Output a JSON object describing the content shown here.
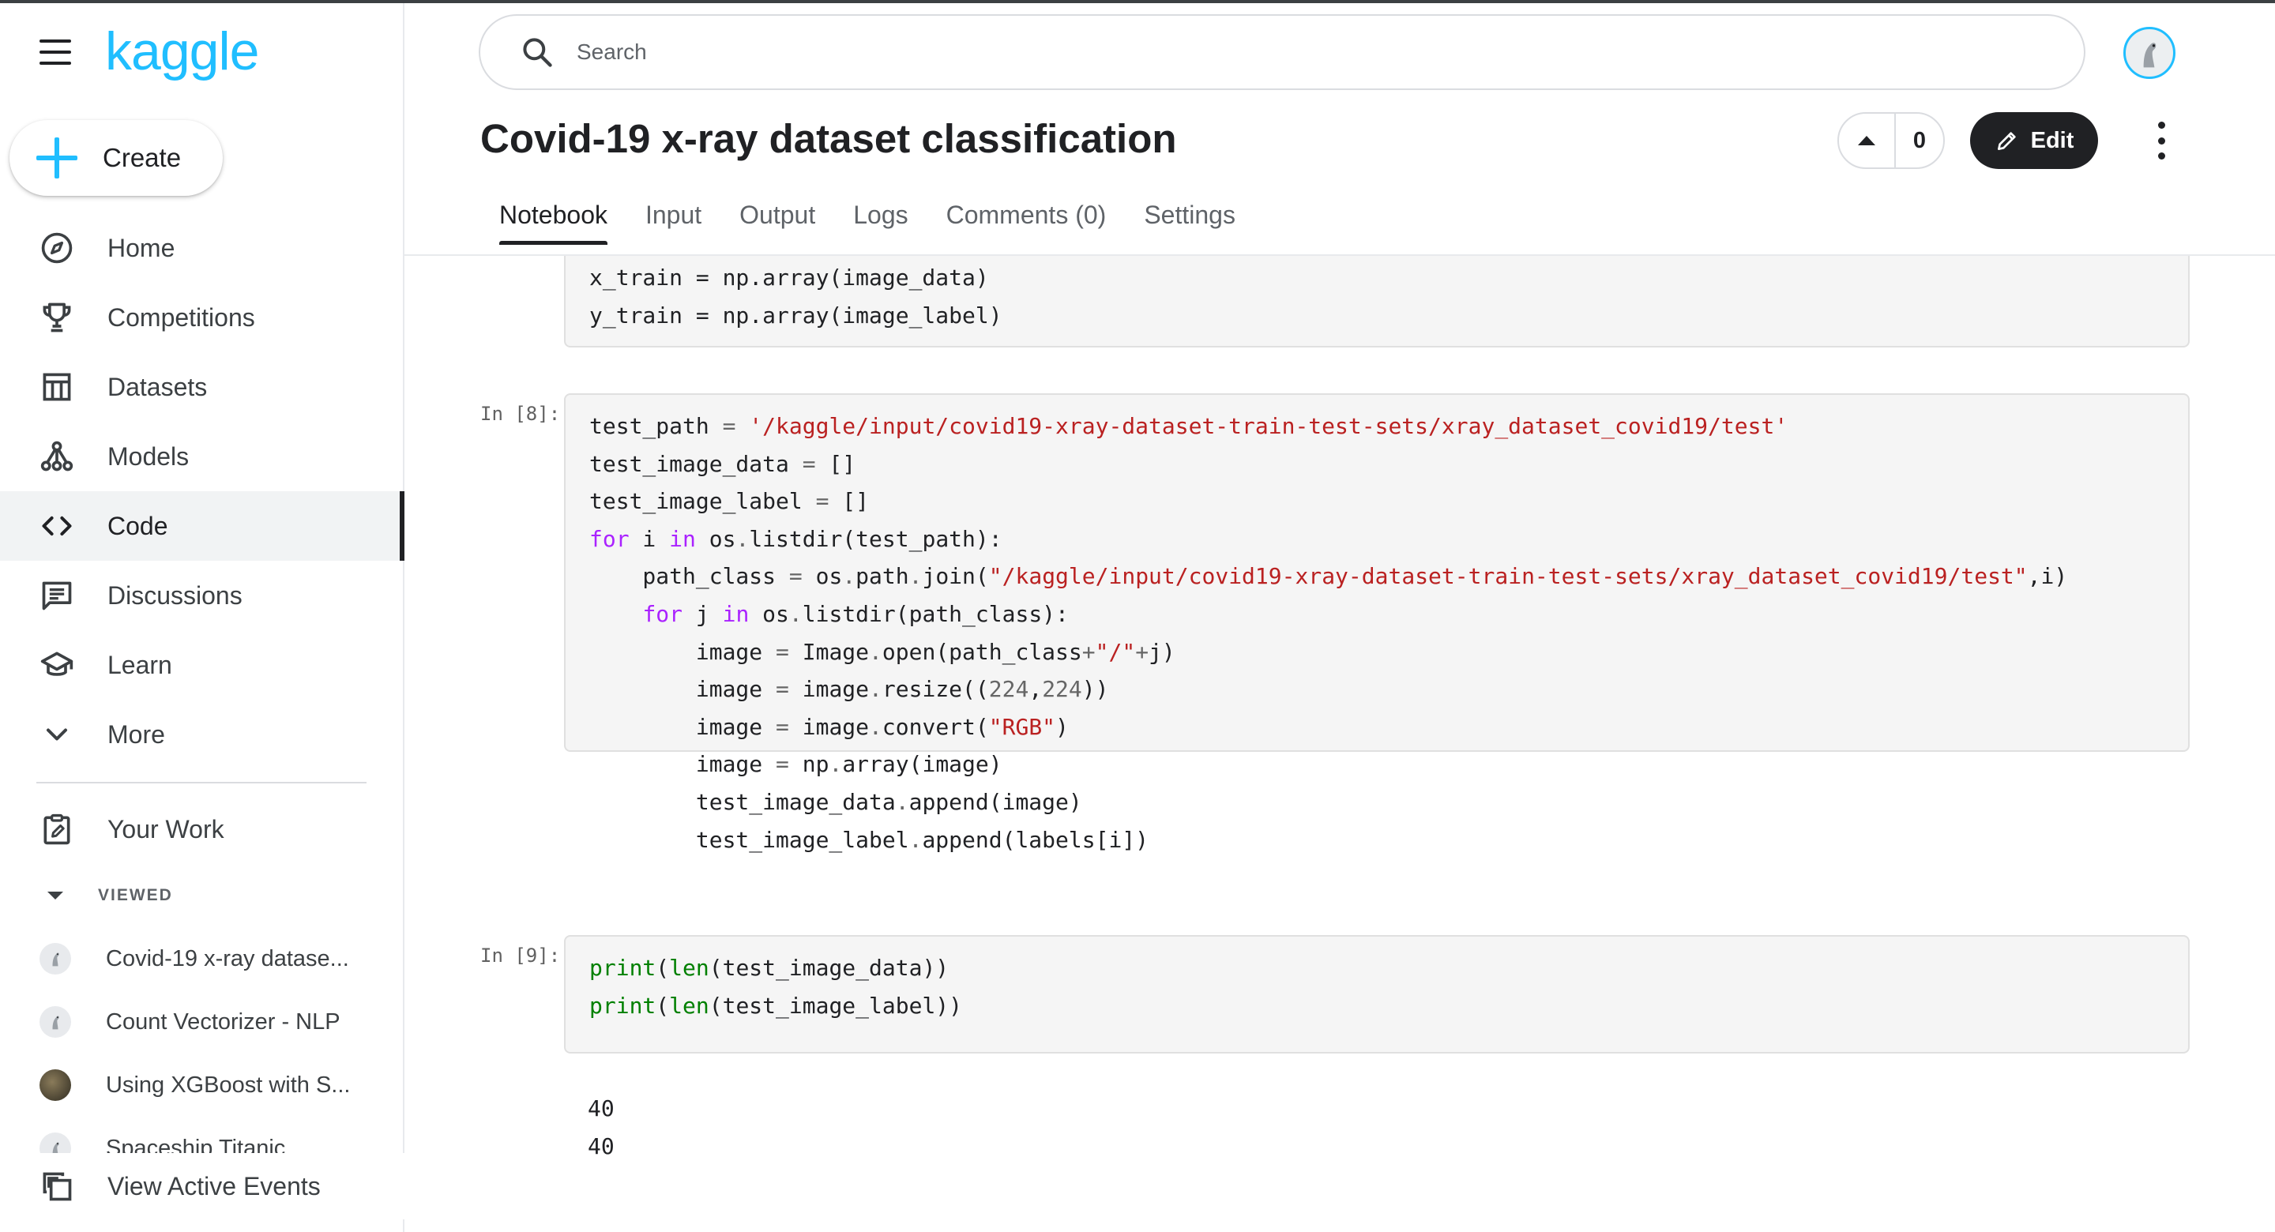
{
  "app": {
    "logo": "kaggle"
  },
  "create": {
    "label": "Create"
  },
  "nav": {
    "items": [
      {
        "label": "Home",
        "icon": "compass-icon"
      },
      {
        "label": "Competitions",
        "icon": "trophy-icon"
      },
      {
        "label": "Datasets",
        "icon": "table-icon"
      },
      {
        "label": "Models",
        "icon": "models-icon"
      },
      {
        "label": "Code",
        "icon": "code-icon",
        "active": true
      },
      {
        "label": "Discussions",
        "icon": "comments-icon"
      },
      {
        "label": "Learn",
        "icon": "graduation-cap-icon"
      },
      {
        "label": "More",
        "icon": "chevron-down-icon"
      }
    ],
    "your_work": "Your Work",
    "viewed_heading": "VIEWED",
    "recent": [
      {
        "label": "Covid-19 x-ray datase..."
      },
      {
        "label": "Count Vectorizer - NLP"
      },
      {
        "label": "Using XGBoost with S..."
      },
      {
        "label": "Spaceship Titanic"
      }
    ],
    "active_events": "View Active Events"
  },
  "search": {
    "placeholder": "Search"
  },
  "notebook": {
    "title": "Covid-19 x-ray dataset classification",
    "vote_count": "0",
    "edit_label": "Edit",
    "tabs": [
      "Notebook",
      "Input",
      "Output",
      "Logs",
      "Comments (0)",
      "Settings"
    ],
    "active_tab": "Notebook"
  },
  "cells": {
    "cell7": {
      "lines": [
        "x_train = np.array(image_data)",
        "y_train = np.array(image_label)"
      ]
    },
    "cell8": {
      "prompt": "In [8]:",
      "lines": [
        "test_path = '/kaggle/input/covid19-xray-dataset-train-test-sets/xray_dataset_covid19/test'",
        "test_image_data = []",
        "test_image_label = []",
        "for i in os.listdir(test_path):",
        "    path_class = os.path.join(\"/kaggle/input/covid19-xray-dataset-train-test-sets/xray_dataset_covid19/test\",i)",
        "    for j in os.listdir(path_class):",
        "        image = Image.open(path_class+\"/\"+j)",
        "        image = image.resize((224,224))",
        "        image = image.convert(\"RGB\")",
        "        image = np.array(image)",
        "        test_image_data.append(image)",
        "        test_image_label.append(labels[i])"
      ]
    },
    "cell9": {
      "prompt": "In [9]:",
      "lines": [
        "print(len(test_image_data))",
        "print(len(test_image_label))"
      ],
      "output": [
        "40",
        "40"
      ]
    }
  },
  "colors": {
    "brand": "#20beff",
    "dark": "#202124",
    "code_bg": "#f5f5f5",
    "string": "#ba2121",
    "builtin": "#008000",
    "keyword": "#aa22ff"
  }
}
